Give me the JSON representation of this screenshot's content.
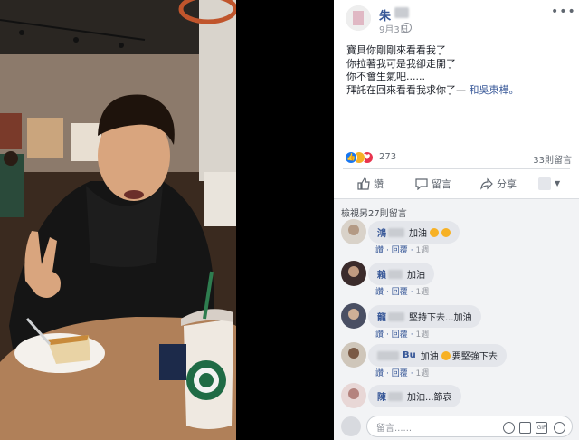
{
  "post": {
    "author": "朱",
    "date": "9月3日 ·",
    "text_lines": [
      "寶貝你剛剛來看看我了",
      "你拉著我可是我卻走開了",
      "你不會生氣吧......",
      "拜託在回來看看我求你了— "
    ],
    "tag": "和吳東樺。",
    "more_label": "•••"
  },
  "reactions": {
    "count": "273",
    "comments": "33則留言"
  },
  "actions": {
    "like": "讚",
    "comment": "留言",
    "share": "分享"
  },
  "comments_section": {
    "view_more": "檢視另27則留言",
    "items": [
      {
        "name": "鴻",
        "text": "加油",
        "emoji_count": 2,
        "meta": {
          "like": "讚",
          "reply": "回覆",
          "time": "1週"
        }
      },
      {
        "name": "賴",
        "text": "加油",
        "emoji_count": 0,
        "meta": {
          "like": "讚",
          "reply": "回覆",
          "time": "1週"
        }
      },
      {
        "name": "龍",
        "text": "堅持下去...加油",
        "emoji_count": 0,
        "meta": {
          "like": "讚",
          "reply": "回覆",
          "time": "1週"
        }
      },
      {
        "name": "Bu",
        "text": "加油",
        "text2": "要堅強下去",
        "emoji_count": 1,
        "meta": {
          "like": "讚",
          "reply": "回覆",
          "time": "1週"
        }
      },
      {
        "name": "陳",
        "text": "加油...節哀",
        "emoji_count": 0,
        "meta": {
          "like": "讚",
          "reply": "回覆",
          "time": "1週"
        }
      }
    ]
  },
  "comment_input": {
    "placeholder": "留言......",
    "gif": "GIF"
  },
  "colors": {
    "link": "#385898",
    "like_blue": "#1877f2",
    "bubble": "#e4e6eb",
    "panel_bg": "#f2f3f5"
  },
  "icons": [
    "like-icon",
    "comment-icon",
    "share-icon",
    "globe-icon",
    "more-icon",
    "emoji-icon",
    "camera-icon",
    "gif-icon",
    "sticker-icon"
  ]
}
